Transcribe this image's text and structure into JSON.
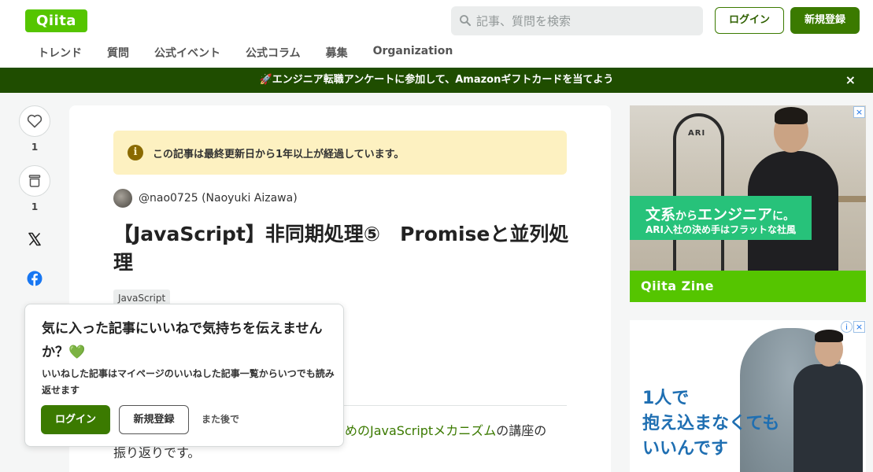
{
  "header": {
    "logo": "Qiita",
    "search_placeholder": "記事、質問を検索",
    "login": "ログイン",
    "signup": "新規登録",
    "nav": [
      "トレンド",
      "質問",
      "公式イベント",
      "公式コラム",
      "募集",
      "Organization"
    ]
  },
  "banner": {
    "text": "🚀エンジニア転職アンケートに参加して、Amazonギフトカードを当てよう",
    "close": "×"
  },
  "side": {
    "like_count": "1",
    "stock_count": "1"
  },
  "article": {
    "notice": "この記事は最終更新日から1年以上が経過しています。",
    "author": "@nao0725 (Naoyuki Aizawa)",
    "title": "【JavaScript】非同期処理⑤　Promiseと並列処理",
    "tag": "JavaScript",
    "body_link": "めのJavaScriptメカニズム",
    "body_rest": "の講座の",
    "body_line2": "振り返りです。"
  },
  "popup": {
    "heading": "気に入った記事にいいねで気持ちを伝えませんか？💚",
    "body": "いいねした記事はマイページのいいねした記事一覧からいつでも読み返せます",
    "login": "ログイン",
    "signup": "新規登録",
    "later": "また後で"
  },
  "ads": {
    "ad1_line1_a": "文系",
    "ad1_line1_b": "から",
    "ad1_line1_c": "エンジニア",
    "ad1_line1_d": "に。",
    "ad1_line2": "ARI入社の決め手はフラットな社風",
    "ad1_brand": "Qiita Zine",
    "ad1_sign": "ARI",
    "ad2_line1": "1人で",
    "ad2_line2": "抱え込まなくても",
    "ad2_line3": "いいんです",
    "ad_info": "i",
    "ad_close": "×"
  }
}
